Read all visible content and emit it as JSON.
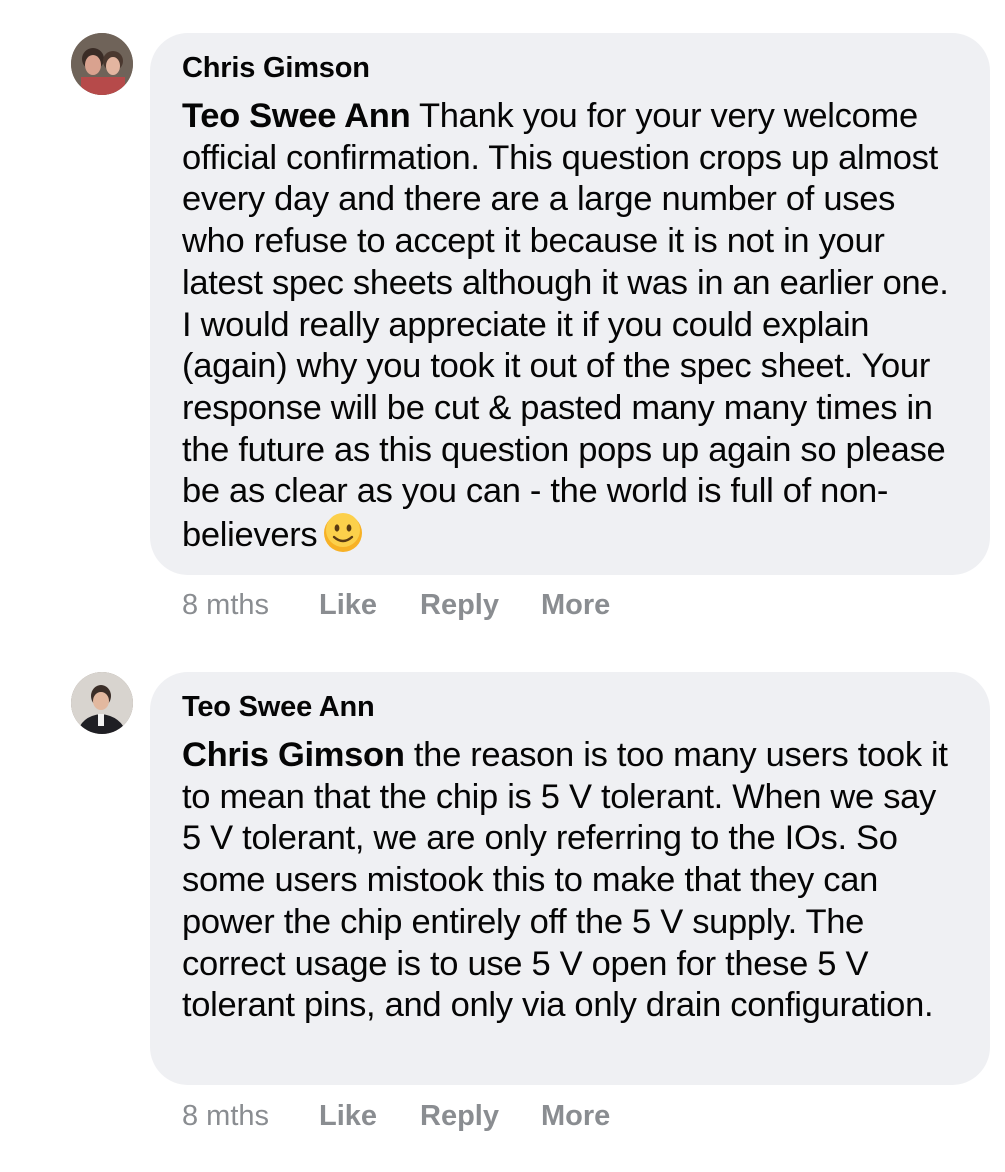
{
  "comments": [
    {
      "author": "Chris Gimson",
      "mention": "Teo Swee Ann",
      "text": " Thank you for your very welcome official confirmation. This question crops up almost every day and there are a large number of uses who refuse to accept it because it is not in your latest spec sheets although it was in an earlier one. I would really appreciate it if you could explain (again) why you took it out of the spec sheet. Your response will be cut & pasted many many times in the future as this question pops up again so please be as clear as you can - the world is full of non-believers",
      "emoji": "smiley-face-icon",
      "time": "8 mths",
      "like_label": "Like",
      "reply_label": "Reply",
      "more_label": "More"
    },
    {
      "author": "Teo Swee Ann",
      "mention": "Chris Gimson",
      "text": " the reason is too many users took it to mean that the chip is 5 V tolerant. When we say 5 V tolerant, we are only referring to the IOs. So some users mistook this to make that they can power the chip entirely off the 5 V supply. The correct usage is to use 5 V open for these 5 V tolerant pins, and only via only drain configuration.",
      "time": "8 mths",
      "like_label": "Like",
      "reply_label": "Reply",
      "more_label": "More"
    }
  ],
  "colors": {
    "bubble": "#eff0f3",
    "text": "#050505",
    "meta": "#8a8d91",
    "emoji": "#f7b125"
  }
}
